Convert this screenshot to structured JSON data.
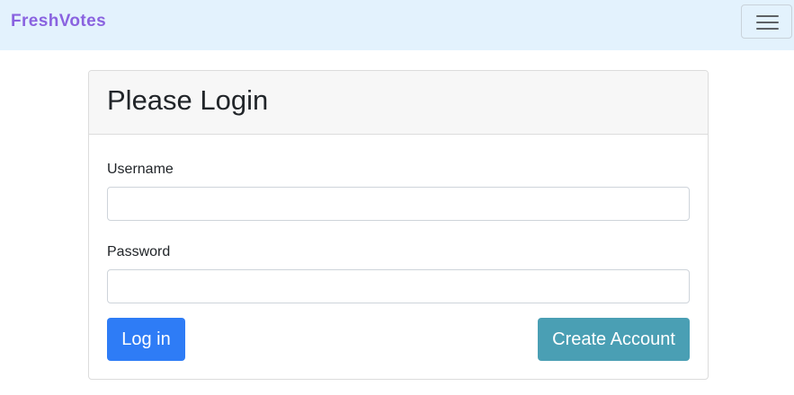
{
  "navbar": {
    "brand": "FreshVotes",
    "toggler_icon": "hamburger-menu-icon"
  },
  "login_card": {
    "title": "Please Login",
    "username": {
      "label": "Username",
      "value": "",
      "placeholder": ""
    },
    "password": {
      "label": "Password",
      "value": "",
      "placeholder": ""
    },
    "login_button": "Log in",
    "create_account_button": "Create Account"
  },
  "colors": {
    "brand": "#8a63e0",
    "navbar_bg": "#e3f2fd",
    "login_button": "#2e7cf6",
    "create_account_button": "#4a9fb4"
  }
}
